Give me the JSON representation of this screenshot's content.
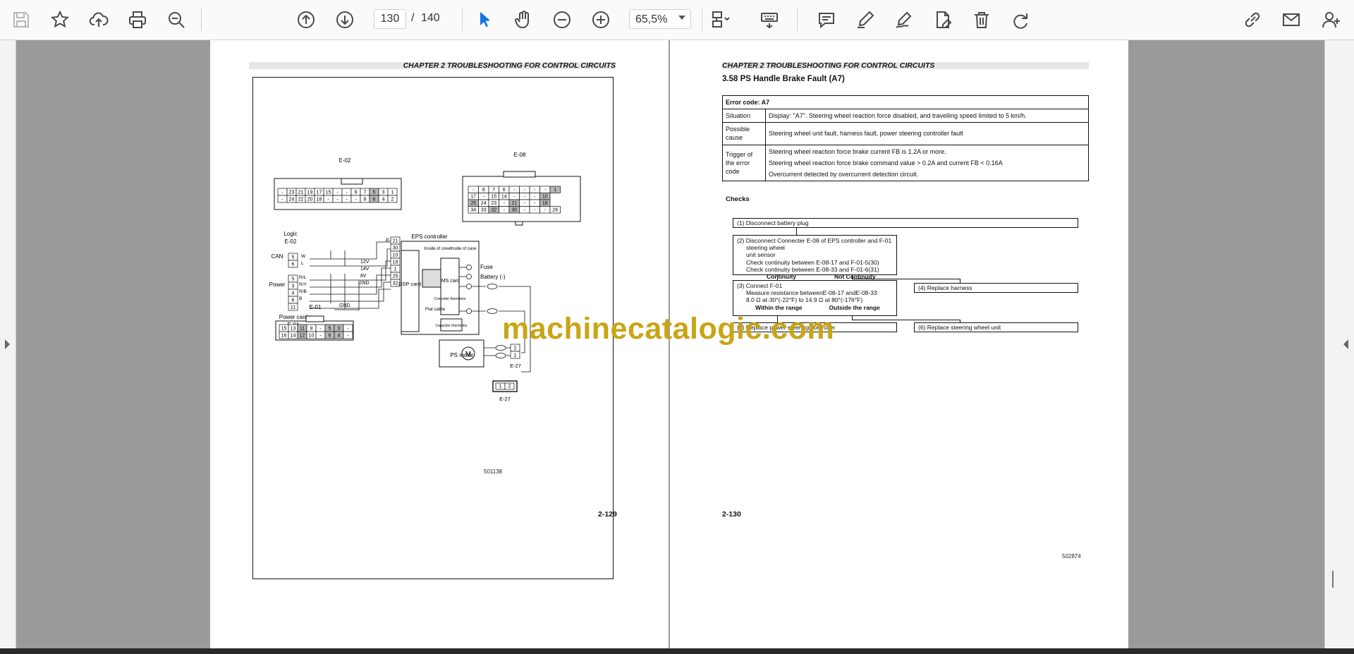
{
  "toolbar": {
    "page_current": "130",
    "page_separator": "/",
    "page_total": "140",
    "zoom": "65,5%"
  },
  "left_page": {
    "chapter_title": "CHAPTER 2 TROUBLESHOOTING FOR CONTROL CIRCUITS",
    "page_number": "2-129",
    "figure_code": "501138",
    "diagram": {
      "e02_label": "E-02",
      "e08_label": "E-08",
      "e01_label": "E-01",
      "e27_label": "E-27",
      "e02_row1": [
        "-",
        "23",
        "21",
        "19",
        "17",
        "15",
        "-",
        "-",
        "9",
        "7",
        "5",
        "3",
        "1"
      ],
      "e02_row2": [
        "-",
        "24",
        "22",
        "20",
        "18",
        "-",
        "-",
        "-",
        "-",
        "8",
        "6",
        "4",
        "2"
      ],
      "e08_row1": [
        "-",
        "8",
        "7",
        "6",
        "-",
        "-",
        "-",
        "-",
        "1"
      ],
      "e08_row2": [
        "17",
        "-",
        "15",
        "14",
        "-",
        "-",
        "-",
        "10"
      ],
      "e08_row3": [
        "25",
        "24",
        "23",
        "-",
        "21",
        "-",
        "-",
        "18"
      ],
      "e08_row4": [
        "34",
        "33",
        "32",
        "-",
        "30",
        "-",
        "-",
        "-",
        "26"
      ],
      "e01_row1": [
        "15",
        "13",
        "11",
        "9",
        "-",
        "5",
        "3",
        "-"
      ],
      "e01_row2": [
        "16",
        "14",
        "12",
        "10",
        "-",
        "6",
        "4",
        "-"
      ],
      "logic_label": "Logic",
      "logic_conn": "E-02",
      "can_label": "CAN",
      "power_label": "Power",
      "power_card_label": "Power card",
      "power_card_conn": "E-01",
      "eps_controller": "EPS controller",
      "e08_side": "E-08",
      "inside_cover": "Inside of cover",
      "inside_case": "Inside of case",
      "dsp_card": "DSP card",
      "ims_card": "IMS card",
      "flat_cable": "Flat cable",
      "controller_thermistor": "Controller thermistor",
      "capacitor_thermistor": "Capacitor thermistor",
      "fuse": "Fuse",
      "battery": "Battery (-)",
      "ps_motor": "PS motor",
      "motor_symbol": "M",
      "v12": "12V",
      "v14": "14V",
      "v8": "8V",
      "gnd": "GND",
      "gnd2": "GND",
      "can_pins": [
        "5",
        "6"
      ],
      "can_wires": [
        "W",
        "L"
      ],
      "power_pins": [
        "5",
        "3",
        "4",
        "6",
        "11"
      ],
      "power_wires": [
        "R/L",
        "R/Y",
        "R/B",
        "B"
      ],
      "e08_pins": [
        "21",
        "30",
        "10",
        "18",
        "1",
        "25",
        "32"
      ],
      "e27_pins": [
        "2",
        "1"
      ],
      "e27_connector": [
        "1",
        "2"
      ]
    }
  },
  "right_page": {
    "chapter_title": "CHAPTER 2 TROUBLESHOOTING FOR CONTROL CIRCUITS",
    "section_title": "3.58    PS Handle Brake Fault (A7)",
    "page_number": "2-130",
    "figure_code": "502874",
    "table": {
      "error_code_label": "Error code:  A7",
      "situation_label": "Situation",
      "situation_value": "Display: \"A7\". Steering wheel reaction force disabled, and travelling speed limited to 5 km/h.",
      "possible_label": "Possible cause",
      "possible_value": "Steering wheel unit fault, harness fault, power steering controller fault",
      "trigger_label": "Trigger of the error code",
      "trigger_1": "Steering wheel reaction force brake current FB is 1.2A or more.",
      "trigger_2": "Steering wheel reaction force brake command value > 0.2A and current FB < 0.16A",
      "trigger_3": "Overcurrent detected by overcurrent detection circuit."
    },
    "checks_title": "Checks",
    "flow": {
      "step1": "(1) Disconnect battery plug",
      "step2_a": "(2) Disconnect Connecter E-08 of EPS controller and F-01",
      "step2_b": "steering wheel",
      "step2_c": "unit sensor",
      "step2_d": "Check continuity between E-08-17 and F-01-5(30)",
      "step2_e": "Check continuity between E-08-33 and F-01-6(31)",
      "step2_yes": "Continuity",
      "step2_no": "Not Continuity",
      "step4": "(4) Replace harness",
      "step3_a": "(3) Connect F-01",
      "step3_b": "Measure resistance betweenE-08-17 andE-08-33",
      "step3_c": "8.0 Ω at-30°(-22°F) to 14.9 Ω at 80°(-176°F)",
      "step3_yes": "Within the range",
      "step3_no": "Outside the range",
      "step5": "(5) Replace power steering controller",
      "step6": "(6) Replace steering wheel unit"
    }
  },
  "watermark": "machinecatalogic.com"
}
